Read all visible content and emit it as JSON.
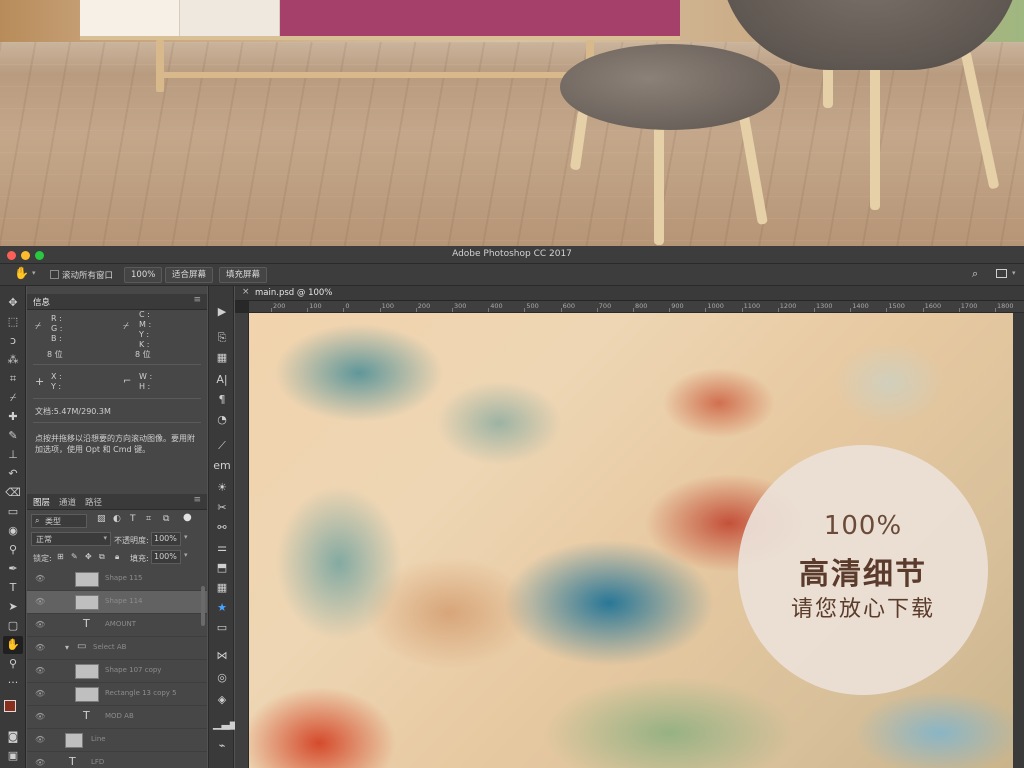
{
  "window": {
    "title": "Adobe Photoshop CC 2017"
  },
  "options_bar": {
    "scroll_all_windows": "滚动所有窗口",
    "zoom_100": "100%",
    "fit_screen": "适合屏幕",
    "fill_screen": "填充屏幕"
  },
  "info_panel": {
    "tab": "信息",
    "r": "R :",
    "g": "G :",
    "b": "B :",
    "bits_left": "8 位",
    "c": "C :",
    "m": "M :",
    "y": "Y :",
    "k": "K :",
    "bits_right": "8 位",
    "x": "X :",
    "y2": "Y :",
    "w": "W :",
    "h": "H :",
    "doc": "文档:5.47M/290.3M",
    "hint": "点按并拖移以沿想要的方向滚动图像。要用附加选项，使用 Opt 和 Cmd 键。"
  },
  "layers_panel": {
    "tabs": [
      "图层",
      "通道",
      "路径"
    ],
    "filter_label": "类型",
    "blend_mode": "正常",
    "opacity_label": "不透明度:",
    "opacity_value": "100%",
    "lock_label": "锁定:",
    "fill_label": "填充:",
    "fill_value": "100%",
    "layers": [
      {
        "name": "Shape 115",
        "kind": "shape"
      },
      {
        "name": "Shape 114",
        "kind": "shape",
        "selected": true
      },
      {
        "name": "AMOUNT",
        "kind": "text"
      },
      {
        "name": "Select AB",
        "kind": "group"
      },
      {
        "name": "Shape 107 copy",
        "kind": "shape"
      },
      {
        "name": "Rectangle 13 copy 5",
        "kind": "shape"
      },
      {
        "name": "MOD AB",
        "kind": "text"
      },
      {
        "name": "Line",
        "kind": "shape"
      },
      {
        "name": "LFD",
        "kind": "text"
      }
    ]
  },
  "document": {
    "tab_title": "main.psd @ 100%",
    "ruler_ticks": [
      "200",
      "100",
      "0",
      "100",
      "200",
      "300",
      "400",
      "500",
      "600",
      "700",
      "800",
      "900",
      "1000",
      "1100",
      "1200",
      "1300",
      "1400",
      "1500",
      "1600",
      "1700",
      "1800"
    ]
  },
  "badge": {
    "line1": "100%",
    "line2": "高清细节",
    "line3": "请您放心下载"
  },
  "colors": {
    "ps_dark": "#3a3a3a",
    "ps_panel": "#474747",
    "badge_text": "#5b3b2b",
    "foreground_swatch": "#8a2f1c",
    "background_swatch": "#ffffff"
  }
}
